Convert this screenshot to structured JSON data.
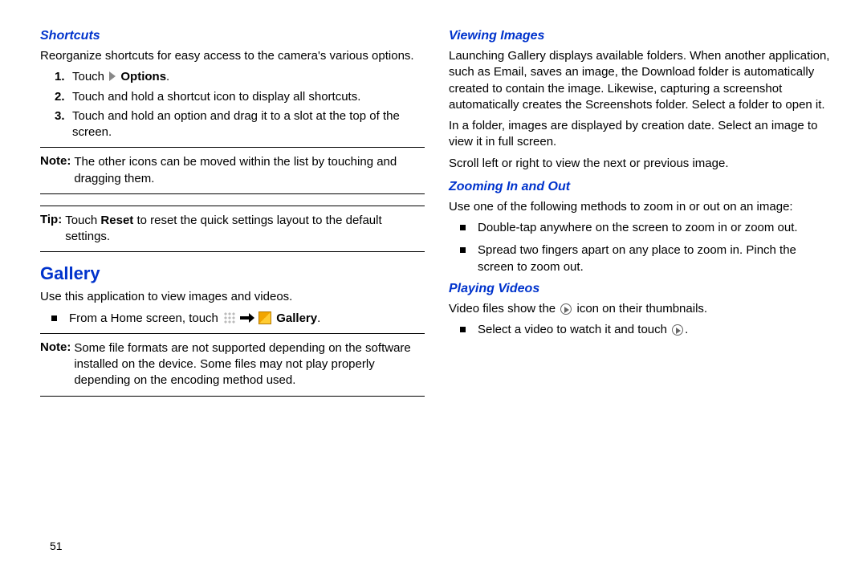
{
  "left": {
    "shortcuts": {
      "heading": "Shortcuts",
      "intro": "Reorganize shortcuts for easy access to the camera's various options.",
      "steps": {
        "s1_pre": "Touch ",
        "s1_bold": "Options",
        "s1_post": ".",
        "s2": "Touch and hold a shortcut icon to display all shortcuts.",
        "s3": "Touch and hold an option and drag it to a slot at the top of the screen."
      },
      "note_label": "Note:",
      "note_text": "The other icons can be moved within the list by touching and dragging them.",
      "tip_label": "Tip:",
      "tip_pre": "Touch ",
      "tip_bold": "Reset",
      "tip_post": " to reset the quick settings layout to the default settings."
    },
    "gallery": {
      "heading": "Gallery",
      "intro": "Use this application to view images and videos.",
      "bullet_pre": "From a Home screen, touch ",
      "bullet_bold": "Gallery",
      "bullet_post": ".",
      "note_label": "Note:",
      "note_text": "Some file formats are not supported depending on the software installed on the device. Some files may not play properly depending on the encoding method used."
    }
  },
  "right": {
    "viewing": {
      "heading": "Viewing Images",
      "p1": "Launching Gallery displays available folders. When another application, such as Email, saves an image, the Download folder is automatically created to contain the image. Likewise, capturing a screenshot automatically creates the Screenshots folder. Select a folder to open it.",
      "p2": "In a folder, images are displayed by creation date. Select an image to view it in full screen.",
      "p3": "Scroll left or right to view the next or previous image."
    },
    "zooming": {
      "heading": "Zooming In and Out",
      "intro": "Use one of the following methods to zoom in or out on an image:",
      "b1": "Double-tap anywhere on the screen to zoom in or zoom out.",
      "b2": "Spread two fingers apart on any place to zoom in. Pinch the screen to zoom out."
    },
    "playing": {
      "heading": "Playing Videos",
      "p_pre": "Video files show the ",
      "p_post": " icon on their thumbnails.",
      "b_pre": "Select a video to watch it and touch ",
      "b_post": "."
    }
  },
  "pagenum": "51"
}
